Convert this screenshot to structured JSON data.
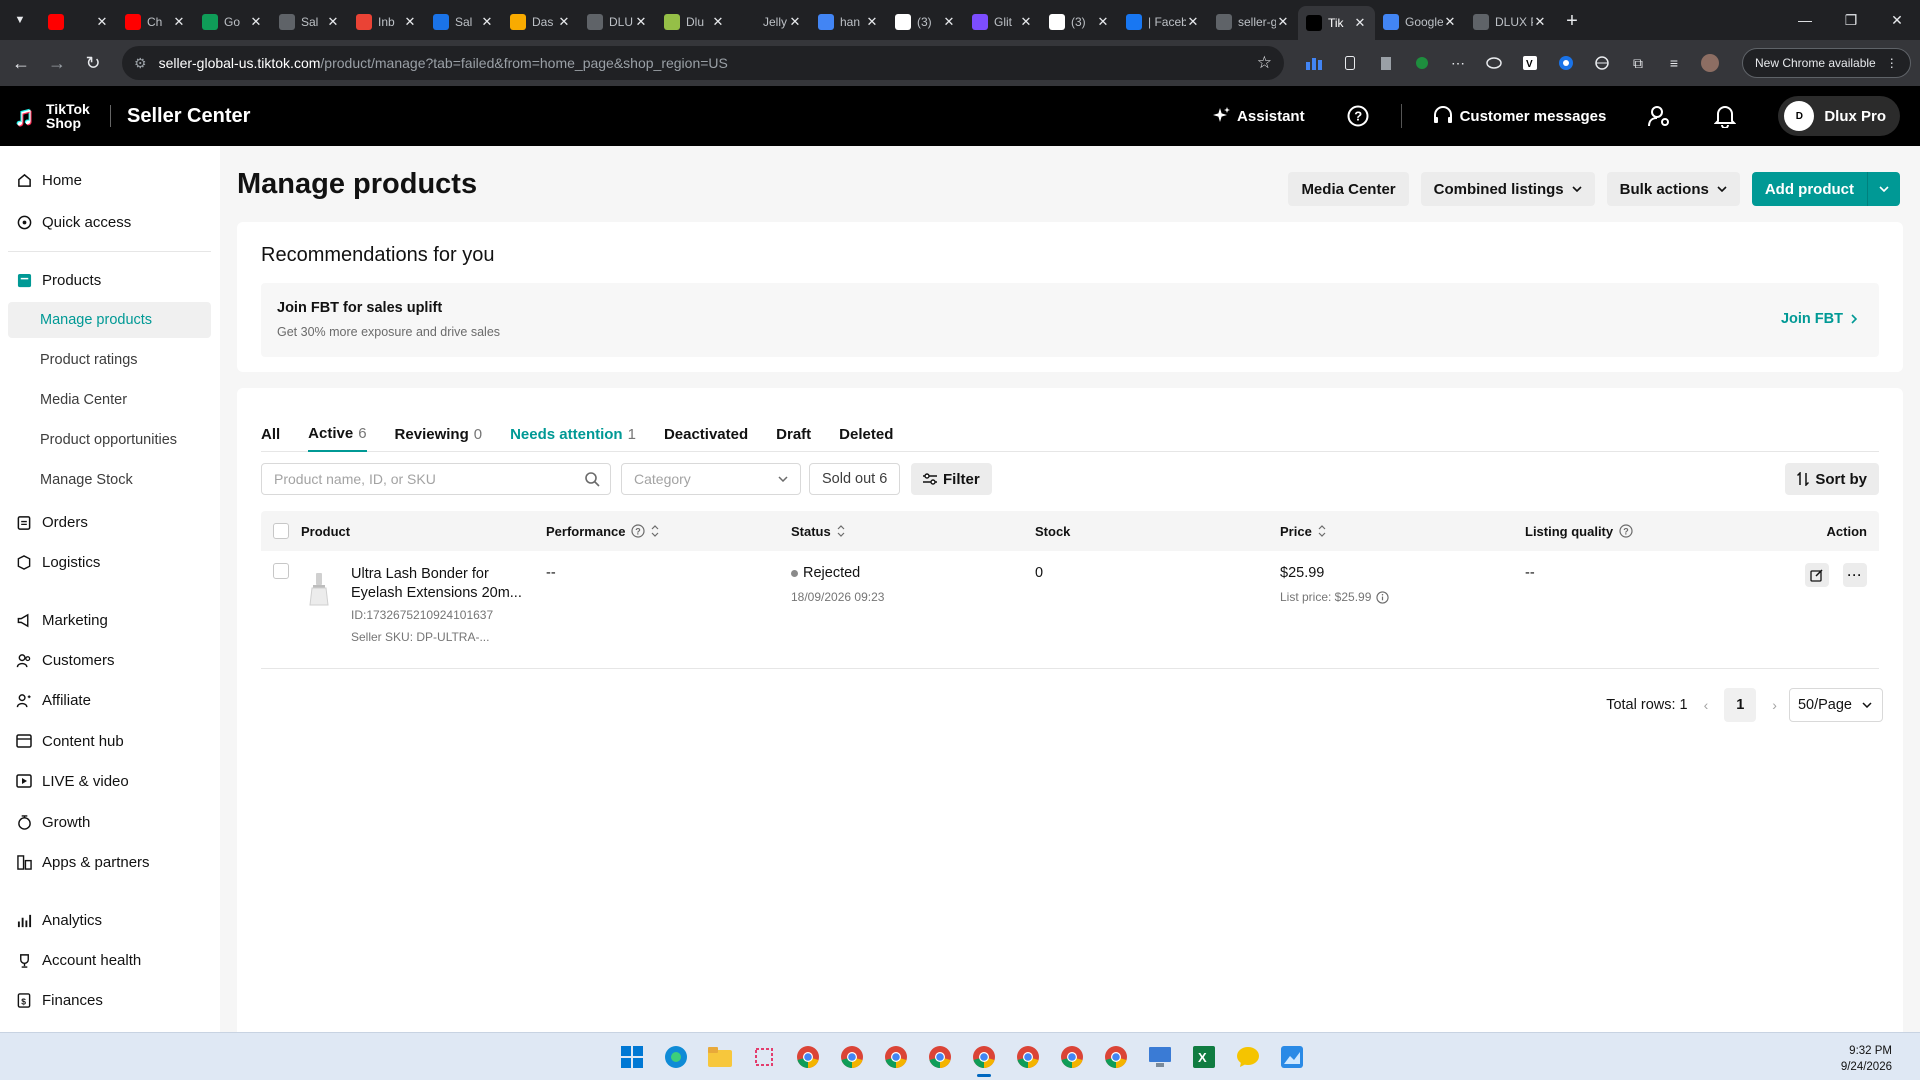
{
  "browser": {
    "tabs": [
      {
        "title": "",
        "icon": "youtube-icon",
        "color": "#ff0000"
      },
      {
        "title": "Ch",
        "icon": "youtube-icon",
        "color": "#ff0000"
      },
      {
        "title": "Go",
        "icon": "sheets-icon",
        "color": "#0f9d58"
      },
      {
        "title": "Sal",
        "icon": "globe-icon",
        "color": "#5f6368"
      },
      {
        "title": "Inb",
        "icon": "gmail-icon",
        "color": "#ea4335"
      },
      {
        "title": "Sal",
        "icon": "app-icon",
        "color": "#1a73e8"
      },
      {
        "title": "Das",
        "icon": "chart-icon",
        "color": "#f9ab00"
      },
      {
        "title": "DLU",
        "icon": "globe-icon",
        "color": "#5f6368"
      },
      {
        "title": "Dlu",
        "icon": "shopify-icon",
        "color": "#95bf47"
      },
      {
        "title": "Jelly",
        "icon": "app-icon",
        "color": "#202124"
      },
      {
        "title": "han",
        "icon": "translate-icon",
        "color": "#4285f4"
      },
      {
        "title": "(3)",
        "icon": "notion-icon",
        "color": "#ffffff"
      },
      {
        "title": "Glit",
        "icon": "glitch-icon",
        "color": "#7c4dff"
      },
      {
        "title": "(3)",
        "icon": "notion-icon",
        "color": "#ffffff"
      },
      {
        "title": "| Facebo",
        "icon": "facebook-icon",
        "color": "#1877f2"
      },
      {
        "title": "seller-g",
        "icon": "globe-icon",
        "color": "#5f6368"
      },
      {
        "title": "Tik",
        "icon": "tiktok-icon",
        "color": "#000000",
        "active": true
      },
      {
        "title": "Google",
        "icon": "google-icon",
        "color": "#4285f4"
      },
      {
        "title": "DLUX P",
        "icon": "globe-icon",
        "color": "#5f6368"
      }
    ],
    "url_host": "seller-global-us.tiktok.com",
    "url_path": "/product/manage?tab=failed&from=home_page&shop_region=US",
    "new_chrome": "New Chrome available"
  },
  "header": {
    "brand_line1": "TikTok",
    "brand_line2": "Shop",
    "app_title": "Seller Center",
    "assistant": "Assistant",
    "customer_messages": "Customer messages",
    "account_name": "Dlux Pro",
    "avatar_text": "D"
  },
  "sidebar": {
    "home": "Home",
    "quick_access": "Quick access",
    "products": "Products",
    "manage_products": "Manage products",
    "product_ratings": "Product ratings",
    "media_center": "Media Center",
    "product_opportunities": "Product opportunities",
    "manage_stock": "Manage Stock",
    "orders": "Orders",
    "logistics": "Logistics",
    "marketing": "Marketing",
    "customers": "Customers",
    "affiliate": "Affiliate",
    "content_hub": "Content hub",
    "live_video": "LIVE & video",
    "growth": "Growth",
    "apps_partners": "Apps & partners",
    "analytics": "Analytics",
    "account_health": "Account health",
    "finances": "Finances"
  },
  "page": {
    "title": "Manage products",
    "media_center_btn": "Media Center",
    "combined_listings_btn": "Combined listings",
    "bulk_actions_btn": "Bulk actions",
    "add_product_btn": "Add product"
  },
  "recommendations": {
    "title": "Recommendations for you",
    "fbt_heading": "Join FBT for sales uplift",
    "fbt_desc": "Get 30% more exposure and drive sales",
    "fbt_link": "Join FBT"
  },
  "product_tabs": {
    "all": "All",
    "active": "Active",
    "active_count": "6",
    "reviewing": "Reviewing",
    "reviewing_count": "0",
    "needs_attention": "Needs attention",
    "needs_attention_count": "1",
    "deactivated": "Deactivated",
    "draft": "Draft",
    "deleted": "Deleted"
  },
  "filters": {
    "search_placeholder": "Product name, ID, or SKU",
    "category_placeholder": "Category",
    "sold_out": "Sold out 6",
    "filter_btn": "Filter",
    "sort_btn": "Sort by"
  },
  "table": {
    "columns": {
      "product": "Product",
      "performance": "Performance",
      "status": "Status",
      "stock": "Stock",
      "price": "Price",
      "listing_quality": "Listing quality",
      "action": "Action"
    },
    "rows": [
      {
        "name_line1": "Ultra Lash Bonder for",
        "name_line2": "Eyelash Extensions 20m...",
        "id": "ID:1732675210924101637",
        "sku": "Seller SKU: DP-ULTRA-...",
        "performance": "--",
        "status": "Rejected",
        "status_time": "18/09/2026 09:23",
        "stock": "0",
        "price": "$25.99",
        "list_price": "List price: $25.99",
        "listing_quality": "--"
      }
    ]
  },
  "pagination": {
    "total_rows": "Total rows: 1",
    "current_page": "1",
    "page_size": "50/Page"
  },
  "taskbar": {
    "time": "9:32 PM",
    "date": "9/24/2026"
  }
}
